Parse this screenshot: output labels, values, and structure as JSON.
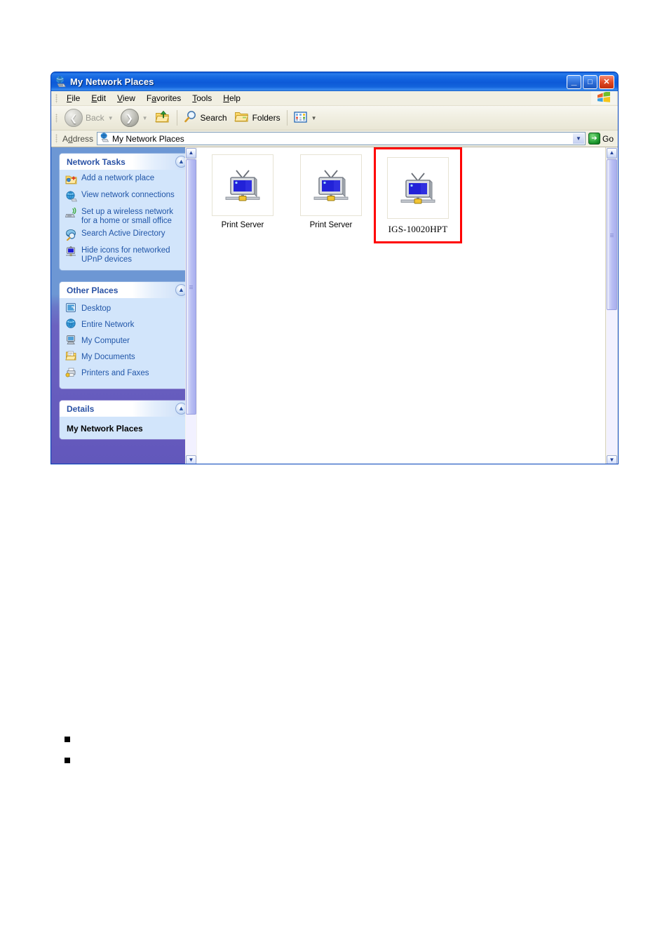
{
  "window": {
    "title": "My Network Places",
    "title_icon": "network-places-icon",
    "buttons": {
      "minimize": "_",
      "maximize": "□",
      "close": "✕"
    }
  },
  "menubar": {
    "items": [
      {
        "label": "File",
        "accel": "F"
      },
      {
        "label": "Edit",
        "accel": "E"
      },
      {
        "label": "View",
        "accel": "V"
      },
      {
        "label": "Favorites",
        "accel": "a"
      },
      {
        "label": "Tools",
        "accel": "T"
      },
      {
        "label": "Help",
        "accel": "H"
      }
    ],
    "brand_icon": "windows-flag-icon"
  },
  "toolbar": {
    "back_label": "Back",
    "back_enabled": false,
    "forward_label": "",
    "up_label": "",
    "search_label": "Search",
    "folders_label": "Folders",
    "views_label": "",
    "icons": {
      "back": "back-arrow-icon",
      "forward": "forward-arrow-icon",
      "up": "up-folder-icon",
      "search": "magnifier-icon",
      "folders": "folder-icon",
      "views": "views-grid-icon"
    }
  },
  "address": {
    "label": "Address",
    "value": "My Network Places",
    "icon": "network-places-icon",
    "go_label": "Go",
    "dropdown_icon": "chevron-down-icon",
    "go_icon": "green-go-arrow-icon"
  },
  "sidebar": {
    "panels": [
      {
        "title": "Network Tasks",
        "collapse_icon": "chevron-up-icon",
        "items": [
          {
            "label": "Add a network place",
            "icon": "add-network-place-icon"
          },
          {
            "label": "View network connections",
            "icon": "network-globe-icon"
          },
          {
            "label": "Set up a wireless network for a home or small office",
            "icon": "wireless-network-icon"
          },
          {
            "label": "Search Active Directory",
            "icon": "search-directory-icon"
          },
          {
            "label": "Hide icons for networked UPnP devices",
            "icon": "upnp-device-icon"
          }
        ]
      },
      {
        "title": "Other Places",
        "collapse_icon": "chevron-up-icon",
        "items": [
          {
            "label": "Desktop",
            "icon": "desktop-icon"
          },
          {
            "label": "Entire Network",
            "icon": "entire-network-icon"
          },
          {
            "label": "My Computer",
            "icon": "my-computer-icon"
          },
          {
            "label": "My Documents",
            "icon": "my-documents-icon"
          },
          {
            "label": "Printers and Faxes",
            "icon": "printers-faxes-icon"
          }
        ]
      },
      {
        "title": "Details",
        "collapse_icon": "chevron-up-icon",
        "detail_heading": "My Network Places"
      }
    ]
  },
  "content": {
    "devices": [
      {
        "label": "Print Server",
        "icon": "upnp-network-device-icon",
        "highlighted": false
      },
      {
        "label": "Print Server",
        "icon": "upnp-network-device-icon",
        "highlighted": false
      },
      {
        "label": "IGS-10020HPT",
        "icon": "upnp-network-device-icon",
        "highlighted": true
      }
    ],
    "highlight_color": "#ff0000"
  },
  "document": {
    "bullets": [
      "",
      ""
    ]
  }
}
